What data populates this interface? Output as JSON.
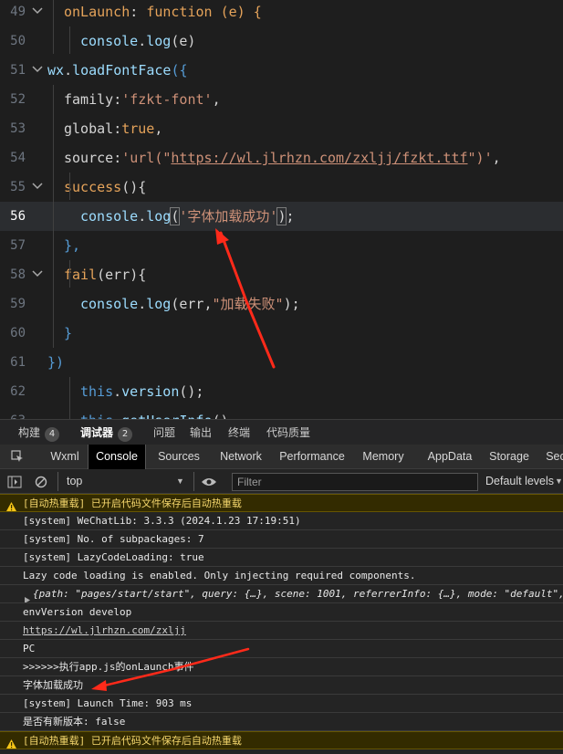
{
  "editor": {
    "lines": [
      {
        "num": "49",
        "parts": [
          {
            "t": "onLaunch",
            "c": "k-orange"
          },
          {
            "t": ": ",
            "c": ""
          },
          {
            "t": "function",
            "c": "k-orange"
          },
          {
            "t": " (e) {",
            "c": "k-orange"
          }
        ]
      },
      {
        "num": "50",
        "parts": [
          {
            "t": "console",
            "c": "k-prop"
          },
          {
            "t": ".",
            "c": ""
          },
          {
            "t": "log",
            "c": "k-prop"
          },
          {
            "t": "(e)",
            "c": ""
          }
        ]
      },
      {
        "num": "51",
        "parts": [
          {
            "t": "wx",
            "c": "k-prop"
          },
          {
            "t": ".",
            "c": ""
          },
          {
            "t": "loadFontFace",
            "c": "k-prop"
          },
          {
            "t": "({",
            "c": "k-kw"
          }
        ]
      },
      {
        "num": "52",
        "parts": [
          {
            "t": "family",
            "c": ""
          },
          {
            "t": ":",
            "c": ""
          },
          {
            "t": "'fzkt-font'",
            "c": "k-str"
          },
          {
            "t": ",",
            "c": ""
          }
        ]
      },
      {
        "num": "53",
        "parts": [
          {
            "t": "global",
            "c": ""
          },
          {
            "t": ":",
            "c": ""
          },
          {
            "t": "true",
            "c": "k-orange"
          },
          {
            "t": ",",
            "c": ""
          }
        ]
      },
      {
        "num": "54",
        "parts": [
          {
            "t": "source",
            "c": ""
          },
          {
            "t": ":",
            "c": ""
          },
          {
            "t": "'url(\"",
            "c": "k-str"
          },
          {
            "t": "https://wl.jlrhzn.com/zxljj/fzkt.ttf",
            "c": "k-url"
          },
          {
            "t": "\")'",
            "c": "k-str"
          },
          {
            "t": ",",
            "c": ""
          }
        ]
      },
      {
        "num": "55",
        "parts": [
          {
            "t": "success",
            "c": "k-orange"
          },
          {
            "t": "(){",
            "c": ""
          }
        ]
      },
      {
        "num": "56",
        "parts": [
          {
            "t": "console",
            "c": "k-prop"
          },
          {
            "t": ".",
            "c": ""
          },
          {
            "t": "log",
            "c": "k-prop"
          },
          {
            "t": "(",
            "c": "bracket-box"
          },
          {
            "t": "'字体加载成功'",
            "c": "k-str"
          },
          {
            "t": ")",
            "c": "bracket-box"
          },
          {
            "t": ";",
            "c": ""
          }
        ]
      },
      {
        "num": "57",
        "parts": [
          {
            "t": "},",
            "c": "k-kw"
          }
        ]
      },
      {
        "num": "58",
        "parts": [
          {
            "t": "fail",
            "c": "k-orange"
          },
          {
            "t": "(err){",
            "c": ""
          }
        ]
      },
      {
        "num": "59",
        "parts": [
          {
            "t": "console",
            "c": "k-prop"
          },
          {
            "t": ".",
            "c": ""
          },
          {
            "t": "log",
            "c": "k-prop"
          },
          {
            "t": "(err,",
            "c": ""
          },
          {
            "t": "\"加载失败\"",
            "c": "k-str"
          },
          {
            "t": ");",
            "c": ""
          }
        ]
      },
      {
        "num": "60",
        "parts": [
          {
            "t": "}",
            "c": "k-kw"
          }
        ]
      },
      {
        "num": "61",
        "parts": [
          {
            "t": "})",
            "c": "k-kw"
          }
        ]
      },
      {
        "num": "62",
        "parts": [
          {
            "t": "this",
            "c": "k-kw"
          },
          {
            "t": ".",
            "c": ""
          },
          {
            "t": "version",
            "c": "k-prop"
          },
          {
            "t": "();",
            "c": ""
          }
        ]
      },
      {
        "num": "63",
        "parts": [
          {
            "t": "this",
            "c": "k-kw"
          },
          {
            "t": ".",
            "c": ""
          },
          {
            "t": "getUserInfo",
            "c": "k-prop"
          },
          {
            "t": "()",
            "c": ""
          }
        ]
      }
    ]
  },
  "panel_tabs": [
    {
      "label": "构建",
      "badge": "4"
    },
    {
      "label": "调试器",
      "badge": "2"
    },
    {
      "label": "问题",
      "badge": ""
    },
    {
      "label": "输出",
      "badge": ""
    },
    {
      "label": "终端",
      "badge": ""
    },
    {
      "label": "代码质量",
      "badge": ""
    }
  ],
  "devtools_tabs": [
    "Wxml",
    "Console",
    "Sources",
    "Network",
    "Performance",
    "Memory",
    "AppData",
    "Storage",
    "Sec"
  ],
  "toolbar": {
    "context": "top",
    "filter_placeholder": "Filter",
    "levels": "Default levels"
  },
  "console": {
    "messages": [
      {
        "type": "warn",
        "text": "[自动热重载] 已开启代码文件保存后自动热重载"
      },
      {
        "type": "log",
        "text": "[system] WeChatLib: 3.3.3 (2024.1.23 17:19:51)"
      },
      {
        "type": "log",
        "text": "[system] No. of subpackages: 7"
      },
      {
        "type": "log",
        "text": "[system] LazyCodeLoading: true"
      },
      {
        "type": "log",
        "text": "Lazy code loading is enabled. Only injecting required components."
      },
      {
        "type": "object",
        "text": "{path: \"pages/start/start\", query: {…}, scene: 1001, referrerInfo: {…}, mode: \"default\", …}"
      },
      {
        "type": "log",
        "text": "envVersion develop"
      },
      {
        "type": "link",
        "text": "https://wl.jlrhzn.com/zxljj"
      },
      {
        "type": "log",
        "text": "PC"
      },
      {
        "type": "log",
        "text": ">>>>>>执行app.js的onLaunch事件"
      },
      {
        "type": "log",
        "text": "字体加载成功"
      },
      {
        "type": "log",
        "text": "[system] Launch Time: 903 ms"
      },
      {
        "type": "log",
        "text": "是否有新版本: false"
      },
      {
        "type": "warn",
        "text": "[自动热重载] 已开启代码文件保存后自动热重载"
      }
    ]
  },
  "colors": {
    "accent": "#ff2a1a",
    "warning": "#f5d76e"
  }
}
